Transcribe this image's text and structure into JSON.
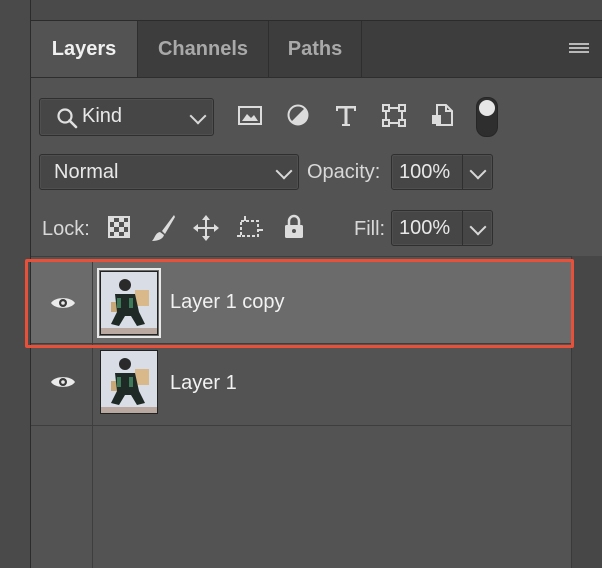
{
  "tabs": [
    {
      "label": "Layers",
      "active": true
    },
    {
      "label": "Channels",
      "active": false
    },
    {
      "label": "Paths",
      "active": false
    }
  ],
  "filter": {
    "kind_label": "Kind",
    "icons": [
      "image-filter-icon",
      "adjustment-filter-icon",
      "type-filter-icon",
      "shape-filter-icon",
      "smart-object-filter-icon",
      "filter-toggle"
    ]
  },
  "blend": {
    "mode": "Normal",
    "opacity_label": "Opacity:",
    "opacity_value": "100%"
  },
  "lock": {
    "label": "Lock:",
    "fill_label": "Fill:",
    "fill_value": "100%"
  },
  "layers": [
    {
      "name": "Layer 1 copy",
      "visible": true,
      "selected": true
    },
    {
      "name": "Layer 1",
      "visible": true,
      "selected": false
    }
  ],
  "colors": {
    "highlight": "#e8503a",
    "panel_bg": "#535353",
    "selected_row": "#6b6b6b"
  }
}
